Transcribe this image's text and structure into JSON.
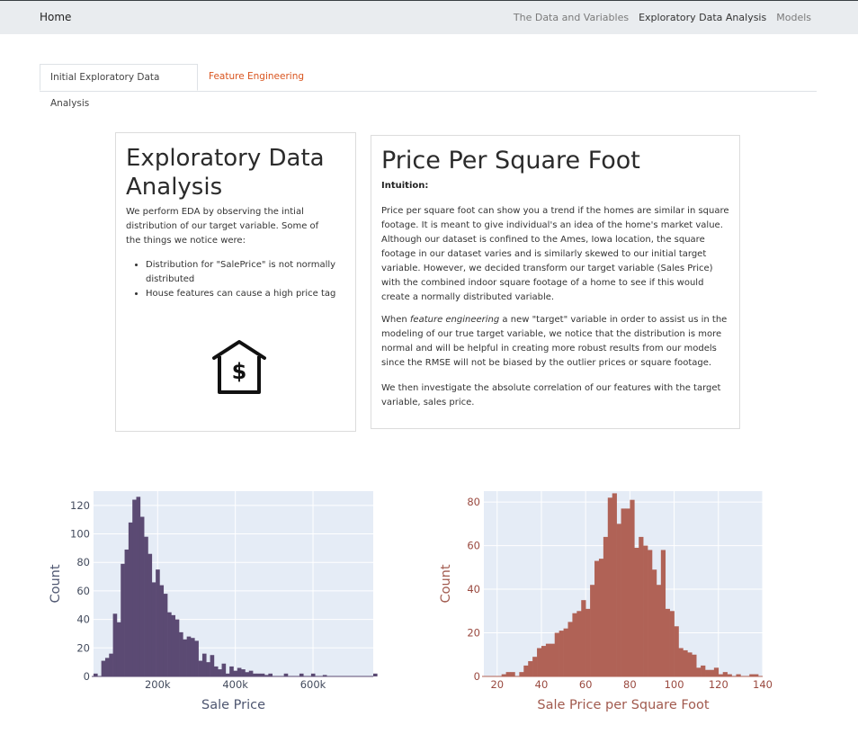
{
  "nav": {
    "brand": "Home",
    "links": [
      "The Data and Variables",
      "Exploratory Data Analysis",
      "Models"
    ]
  },
  "tabs": [
    "Initial Exploratory Data Analysis",
    "Feature Engineering"
  ],
  "card1": {
    "title": "Exploratory Data Analysis",
    "intro": "We perform EDA by observing the intial distribution of our target variable. Some of the things we notice were:",
    "bullets": [
      "Distribution for \"SalePrice\" is not normally distributed",
      "House features can cause a high price tag"
    ],
    "icon": "house-dollar-icon"
  },
  "card2": {
    "title": "Price Per Square Foot",
    "intuition_label": "Intuition:",
    "p1": "Price per square foot can show you a trend if the homes are similar in square footage. It is meant to give individual's an idea of the home's market value. Although our dataset is confined to the Ames, Iowa location, the square footage in our dataset varies and is similarly skewed to our initial target variable. However, we decided transform our target variable (Sales Price) with the combined indoor square footage of a home to see if this would create a normally distributed variable.",
    "p2_before": "When ",
    "p2_em": "feature engineering",
    "p2_after": " a new \"target\" variable in order to assist us in the modeling of our true target variable, we notice that the distribution is more normal and will be helpful in creating more robust results from our models since the RMSE will not be biased by the outlier prices or square footage.",
    "p3": "We then investigate the absolute correlation of our features with the target variable, sales price."
  },
  "chart_data": [
    {
      "type": "bar",
      "xlabel": "Sale Price",
      "ylabel": "Count",
      "xlim": [
        35000,
        755000
      ],
      "ylim": [
        0,
        130
      ],
      "xticks": [
        200000,
        400000,
        600000
      ],
      "xtick_labels": [
        "200k",
        "400k",
        "600k"
      ],
      "yticks": [
        0,
        20,
        40,
        60,
        80,
        100,
        120
      ],
      "bin_start": 35000,
      "bin_width": 10000,
      "values": [
        2,
        0,
        11,
        13,
        16,
        44,
        38,
        79,
        89,
        108,
        124,
        126,
        112,
        98,
        86,
        66,
        75,
        64,
        58,
        45,
        43,
        40,
        31,
        26,
        28,
        27,
        25,
        11,
        16,
        10,
        15,
        7,
        5,
        9,
        2,
        7,
        4,
        6,
        5,
        3,
        4,
        2,
        2,
        2,
        1,
        2,
        0,
        0,
        0,
        2,
        0,
        0,
        0,
        2,
        0,
        0,
        2,
        0,
        0,
        1,
        0,
        0,
        0,
        0,
        0,
        0,
        0,
        0,
        0,
        0,
        0,
        0,
        2
      ],
      "color": "#5b4a73",
      "bg": "#e5ecf6"
    },
    {
      "type": "bar",
      "xlabel": "Sale Price per Square Foot",
      "ylabel": "Count",
      "xlim": [
        14,
        140
      ],
      "ylim": [
        0,
        85
      ],
      "xticks": [
        20,
        40,
        60,
        80,
        100,
        120,
        140
      ],
      "yticks": [
        0,
        20,
        40,
        60,
        80
      ],
      "bin_start": 14,
      "bin_width": 2,
      "values": [
        0,
        0,
        0,
        0,
        1,
        2,
        2,
        0,
        2,
        5,
        7,
        9,
        13,
        14,
        15,
        15,
        20,
        21,
        22,
        25,
        29,
        30,
        35,
        31,
        42,
        53,
        54,
        64,
        82,
        84,
        70,
        77,
        77,
        81,
        59,
        64,
        60,
        58,
        49,
        42,
        58,
        31,
        30,
        23,
        13,
        12,
        11,
        10,
        4,
        5,
        3,
        3,
        4,
        1,
        2,
        1,
        0,
        1,
        0,
        0,
        1,
        1,
        0,
        0,
        0
      ],
      "color": "#b06256",
      "bg": "#e5ecf6"
    }
  ]
}
